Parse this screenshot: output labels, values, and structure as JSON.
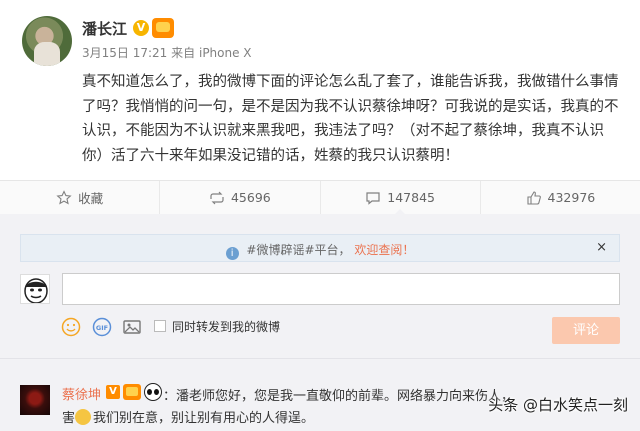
{
  "post": {
    "username": "潘长江",
    "verified_badge": "V",
    "timestamp": "3月15日 17:21",
    "source_prefix": "来自",
    "source": "iPhone X",
    "text": "真不知道怎么了，我的微博下面的评论怎么乱了套了，谁能告诉我，我做错什么事情了吗？我悄悄的问一句，是不是因为我不认识蔡徐坤呀？可我说的是实话，我真的不认识，不能因为不认识就来黑我吧，我违法了吗？（对不起了蔡徐坤，我真不认识你）活了六十来年如果没记错的话，姓蔡的我只认识蔡明！"
  },
  "actions": {
    "favorite_label": "收藏",
    "repost_count": "45696",
    "comment_count": "147845",
    "like_count": "432976"
  },
  "notice": {
    "prefix": "#微博辟谣#平台，",
    "link": "欢迎查阅！",
    "close": "×"
  },
  "composer": {
    "repost_label": "同时转发到我的微博",
    "submit_label": "评论"
  },
  "comment": {
    "author": "蔡徐坤",
    "badge": "V",
    "line1": "：潘老师您好，您是我一直敬仰的前辈。网络暴力向来伤人，",
    "line2_prefix": "害",
    "line2_rest": "我们别在意，别让别有用心的人得逞。"
  },
  "watermark": "头条 @白水笑点一刻",
  "colors": {
    "accent": "#eb7350",
    "submit_disabled": "#fbc8ae",
    "panel_bg": "#f2f2f5",
    "notice_bg": "#e9eff5"
  }
}
